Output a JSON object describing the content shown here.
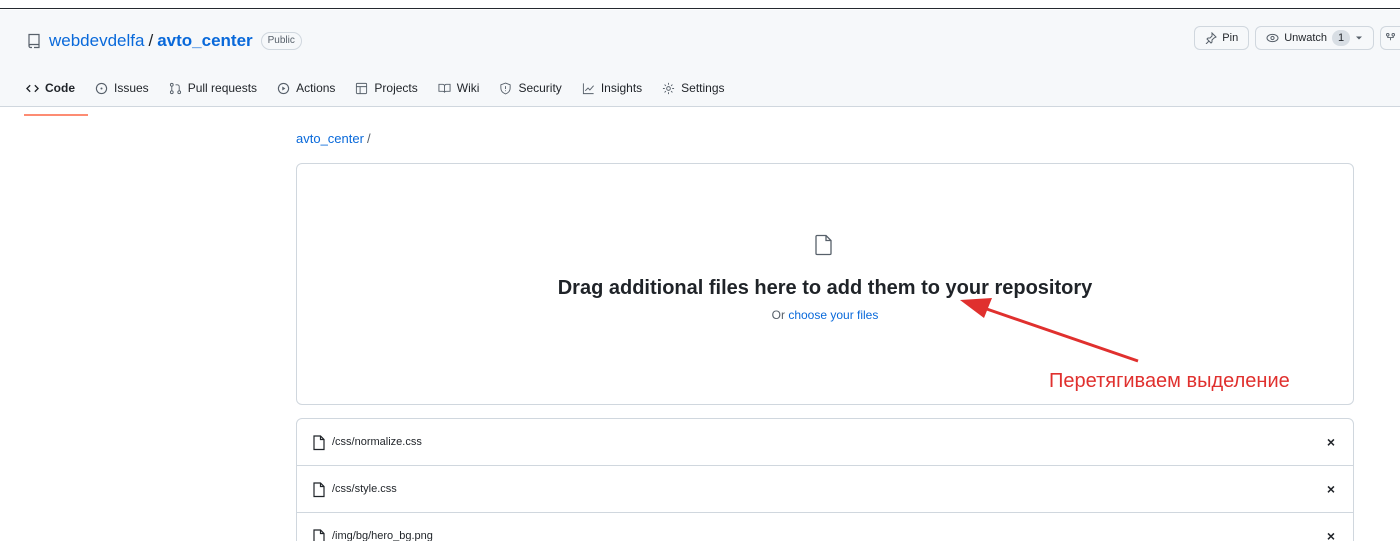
{
  "header": {
    "owner": "webdevdelfa",
    "separator": "/",
    "repo_name": "avto_center",
    "visibility_badge": "Public",
    "pin_label": "Pin",
    "unwatch_label": "Unwatch",
    "watch_count": "1"
  },
  "tabs": [
    {
      "label": "Code",
      "icon": "code-icon",
      "selected": true
    },
    {
      "label": "Issues",
      "icon": "issue-icon"
    },
    {
      "label": "Pull requests",
      "icon": "pull-request-icon"
    },
    {
      "label": "Actions",
      "icon": "play-icon"
    },
    {
      "label": "Projects",
      "icon": "table-icon"
    },
    {
      "label": "Wiki",
      "icon": "book-icon"
    },
    {
      "label": "Security",
      "icon": "shield-icon"
    },
    {
      "label": "Insights",
      "icon": "graph-icon"
    },
    {
      "label": "Settings",
      "icon": "gear-icon"
    }
  ],
  "breadcrumb": {
    "repo": "avto_center",
    "separator": "/"
  },
  "dropzone": {
    "title": "Drag additional files here to add them to your repository",
    "or_text": "Or",
    "choose_link": "choose your files"
  },
  "annotation": {
    "text": "Перетягиваем выделение",
    "color": "#e0302e"
  },
  "files": [
    {
      "path": "/css/normalize.css",
      "remove": "×"
    },
    {
      "path": "/css/style.css",
      "remove": "×"
    },
    {
      "path": "/img/bg/hero_bg.png",
      "remove": "×"
    }
  ],
  "colors": {
    "link": "#0969da",
    "tab_underline": "#fd8c73",
    "border": "#d0d7de",
    "header_bg": "#f6f8fa"
  }
}
